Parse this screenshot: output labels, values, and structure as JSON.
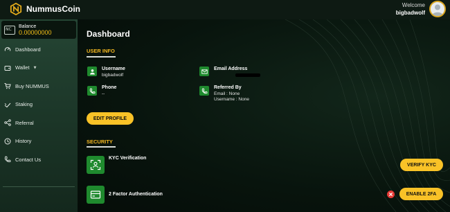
{
  "app": {
    "name": "NummusCoin"
  },
  "user": {
    "welcome": "Welcome",
    "username": "bigbadwolf"
  },
  "balance": {
    "label": "Balance",
    "value": "0.00000000"
  },
  "nav": [
    {
      "label": "Dashboard",
      "icon": "dashboard-icon"
    },
    {
      "label": "Wallet",
      "icon": "wallet-icon"
    },
    {
      "label": "Buy NUMMUS",
      "icon": "cart-icon"
    },
    {
      "label": "Staking",
      "icon": "staking-icon"
    },
    {
      "label": "Referral",
      "icon": "share-icon"
    },
    {
      "label": "History",
      "icon": "history-icon"
    },
    {
      "label": "Contact Us",
      "icon": "phone-icon"
    }
  ],
  "dashboard": {
    "title": "Dashboard",
    "user_info_title": "USER INFO",
    "username_label": "Username",
    "username_value": "bigbadwolf",
    "email_label": "Email Address",
    "phone_label": "Phone",
    "phone_value": "--",
    "referred_label": "Referred By",
    "referred_email": "Email : None",
    "referred_username": "Username : None",
    "edit_profile": "EDIT PROFILE",
    "security_title": "SECURITY",
    "kyc_label": "KYC Verification",
    "verify_kyc": "VERIFY KYC",
    "twofa_label": "2 Factor Authentication",
    "enable_2fa": "ENABLE 2FA"
  },
  "colors": {
    "accent": "#f9c227",
    "green": "#1f8a2e",
    "sidebar": "#254534",
    "danger": "#e53935"
  }
}
